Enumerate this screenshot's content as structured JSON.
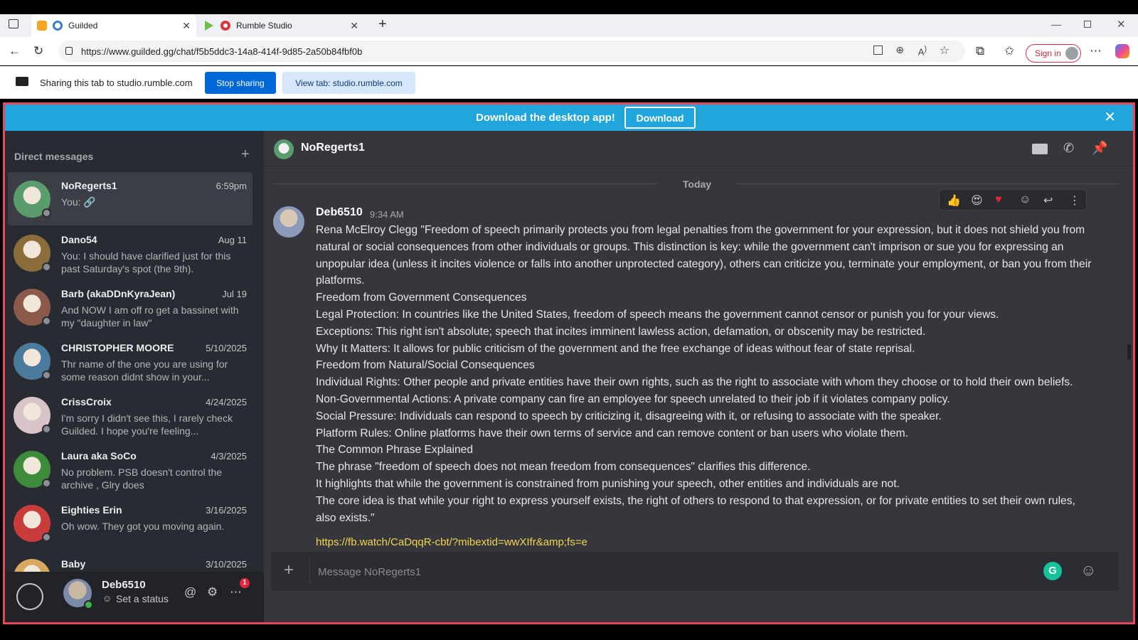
{
  "browser": {
    "tabs": [
      {
        "label": "Guilded",
        "active": true
      },
      {
        "label": "Rumble Studio",
        "active": false
      }
    ],
    "url": "https://www.guilded.gg/chat/f5b5ddc3-14a8-414f-9d85-2a50b84fbf0b",
    "sign_in": "Sign in"
  },
  "sharebar": {
    "text": "Sharing this tab to studio.rumble.com",
    "stop_label": "Stop sharing",
    "view_label": "View tab: studio.rumble.com"
  },
  "banner": {
    "text": "Download the desktop app!",
    "download_label": "Download"
  },
  "sidebar": {
    "title": "Direct messages",
    "items": [
      {
        "name": "NoRegerts1",
        "date": "6:59pm",
        "preview": "You: 🔗",
        "color": "#5a9c6e"
      },
      {
        "name": "Dano54",
        "date": "Aug 11",
        "preview": "You: I should have clarified just for this past Saturday's spot (the 9th).",
        "color": "#8a6d3b"
      },
      {
        "name": "Barb (akaDDnKyraJean)",
        "date": "Jul 19",
        "preview": "And NOW I am off ro get a bassinet with my \"daughter in law\"",
        "color": "#8c5a4a"
      },
      {
        "name": "CHRISTOPHER MOORE",
        "date": "5/10/2025",
        "preview": "Thr name of the one you are using for some reason didnt show in your...",
        "color": "#4a7a9c"
      },
      {
        "name": "CrissCroix",
        "date": "4/24/2025",
        "preview": "I'm sorry I didn't see this, I rarely check Guilded. I hope you're feeling...",
        "color": "#d8c4c8"
      },
      {
        "name": "Laura aka SoCo",
        "date": "4/3/2025",
        "preview": "No problem. PSB doesn't control the archive , Glry does",
        "color": "#3c8c3c"
      },
      {
        "name": "Eighties Erin",
        "date": "3/16/2025",
        "preview": "Oh wow. They got you moving again.",
        "color": "#c83c3c"
      },
      {
        "name": "Baby",
        "date": "3/10/2025",
        "preview": "",
        "color": "#d8a860"
      }
    ],
    "user": {
      "name": "Deb6510",
      "status": "Set a status",
      "badge": "1"
    }
  },
  "chat": {
    "title": "NoRegerts1",
    "day": "Today",
    "message": {
      "author": "Deb6510",
      "time": "9:34 AM",
      "lines": [
        "Rena McElroy Clegg \"Freedom of speech primarily protects you from legal penalties from the government for your expression, but it does not shield you from natural or social consequences from other individuals or groups. This distinction is key: while the government can't imprison or sue you for expressing an unpopular idea (unless it incites violence or falls into another unprotected category), others can criticize you, terminate your employment, or ban you from their platforms.",
        "Freedom from Government Consequences",
        "Legal Protection: In countries like the United States, freedom of speech means the government cannot censor or punish you for your views.",
        "Exceptions: This right isn't absolute; speech that incites imminent lawless action, defamation, or obscenity may be restricted.",
        "Why It Matters: It allows for public criticism of the government and the free exchange of ideas without fear of state reprisal.",
        "Freedom from Natural/Social Consequences",
        "Individual Rights: Other people and private entities have their own rights, such as the right to associate with whom they choose or to hold their own beliefs.",
        "Non-Governmental Actions: A private company can fire an employee for speech unrelated to their job if it violates company policy.",
        "Social Pressure: Individuals can respond to speech by criticizing it, disagreeing with it, or refusing to associate with the speaker.",
        "Platform Rules: Online platforms have their own terms of service and can remove content or ban users who violate them.",
        "The Common Phrase Explained",
        "The phrase \"freedom of speech does not mean freedom from consequences\" clarifies this difference.",
        "It highlights that while the government is constrained from punishing your speech, other entities and individuals are not.",
        "The core idea is that while your right to express yourself exists, the right of others to respond to that expression, or for private entities to set their own rules, also exists.\""
      ],
      "link": "https://fb.watch/CaDqqR-cbt/?mibextid=wwXIfr&amp;fs=e"
    },
    "composer_placeholder": "Message NoRegerts1"
  },
  "colors": {
    "accent": "#20a5dc",
    "link": "#f5d44f",
    "frame": "#e3495a"
  }
}
